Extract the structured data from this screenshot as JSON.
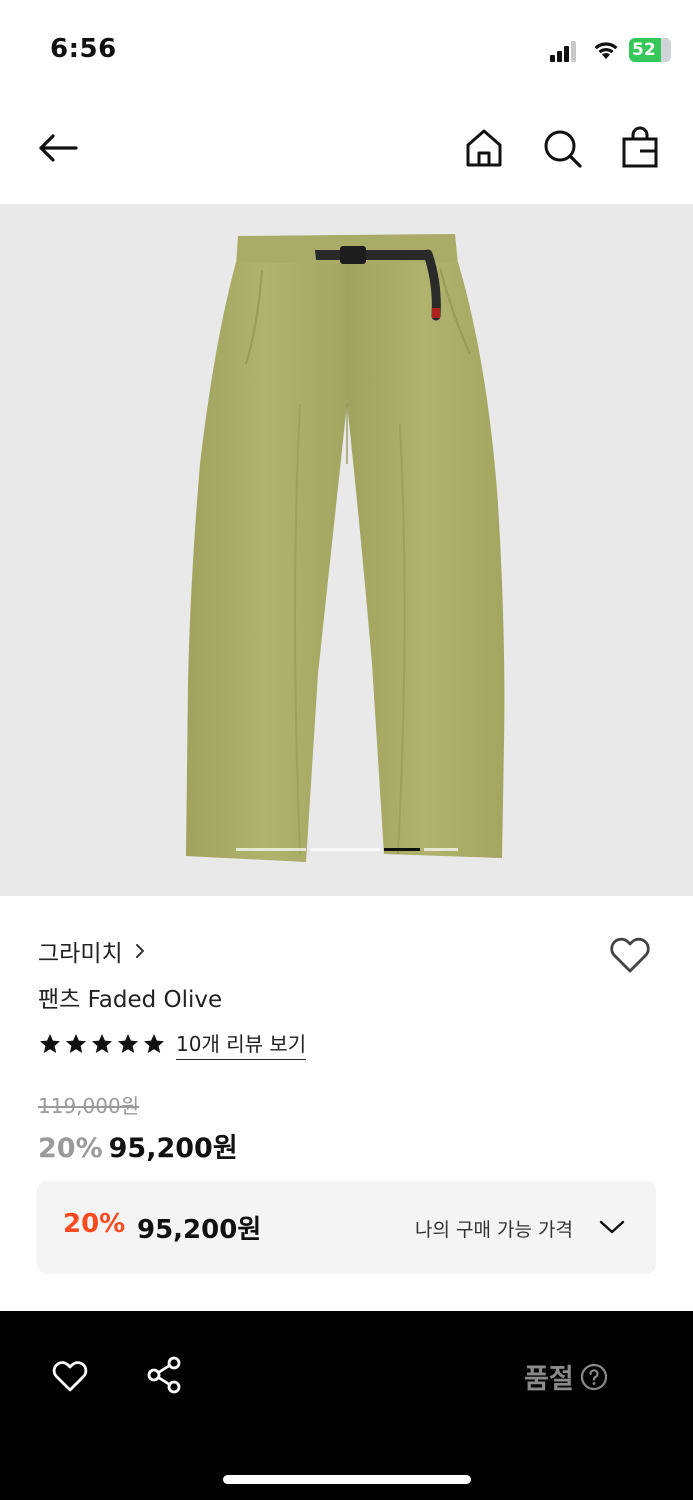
{
  "status": {
    "time": "6:56",
    "battery": "52"
  },
  "nav": {
    "icons": [
      "back-arrow-icon",
      "home-icon",
      "search-icon",
      "shopping-bag-icon"
    ]
  },
  "product": {
    "image_subject": "olive chino pants",
    "gallery_current_index": 3,
    "gallery_count": 3,
    "brand": "그라미치",
    "name": "팬츠 Faded Olive",
    "rating_stars": 5,
    "review_link": "10개 리뷰 보기",
    "original_price": "119,000원",
    "discount": "20%",
    "price": "95,200원"
  },
  "my_price": {
    "discount": "20%",
    "price": "95,200원",
    "label": "나의 구매 가능 가격"
  },
  "bottom_bar": {
    "status_label": "품절"
  },
  "colors": {
    "accent_discount": "#ff4b1f",
    "pants": "#a9ad67",
    "image_bg": "#e9e9ea",
    "bottom_bar": "#000000"
  }
}
